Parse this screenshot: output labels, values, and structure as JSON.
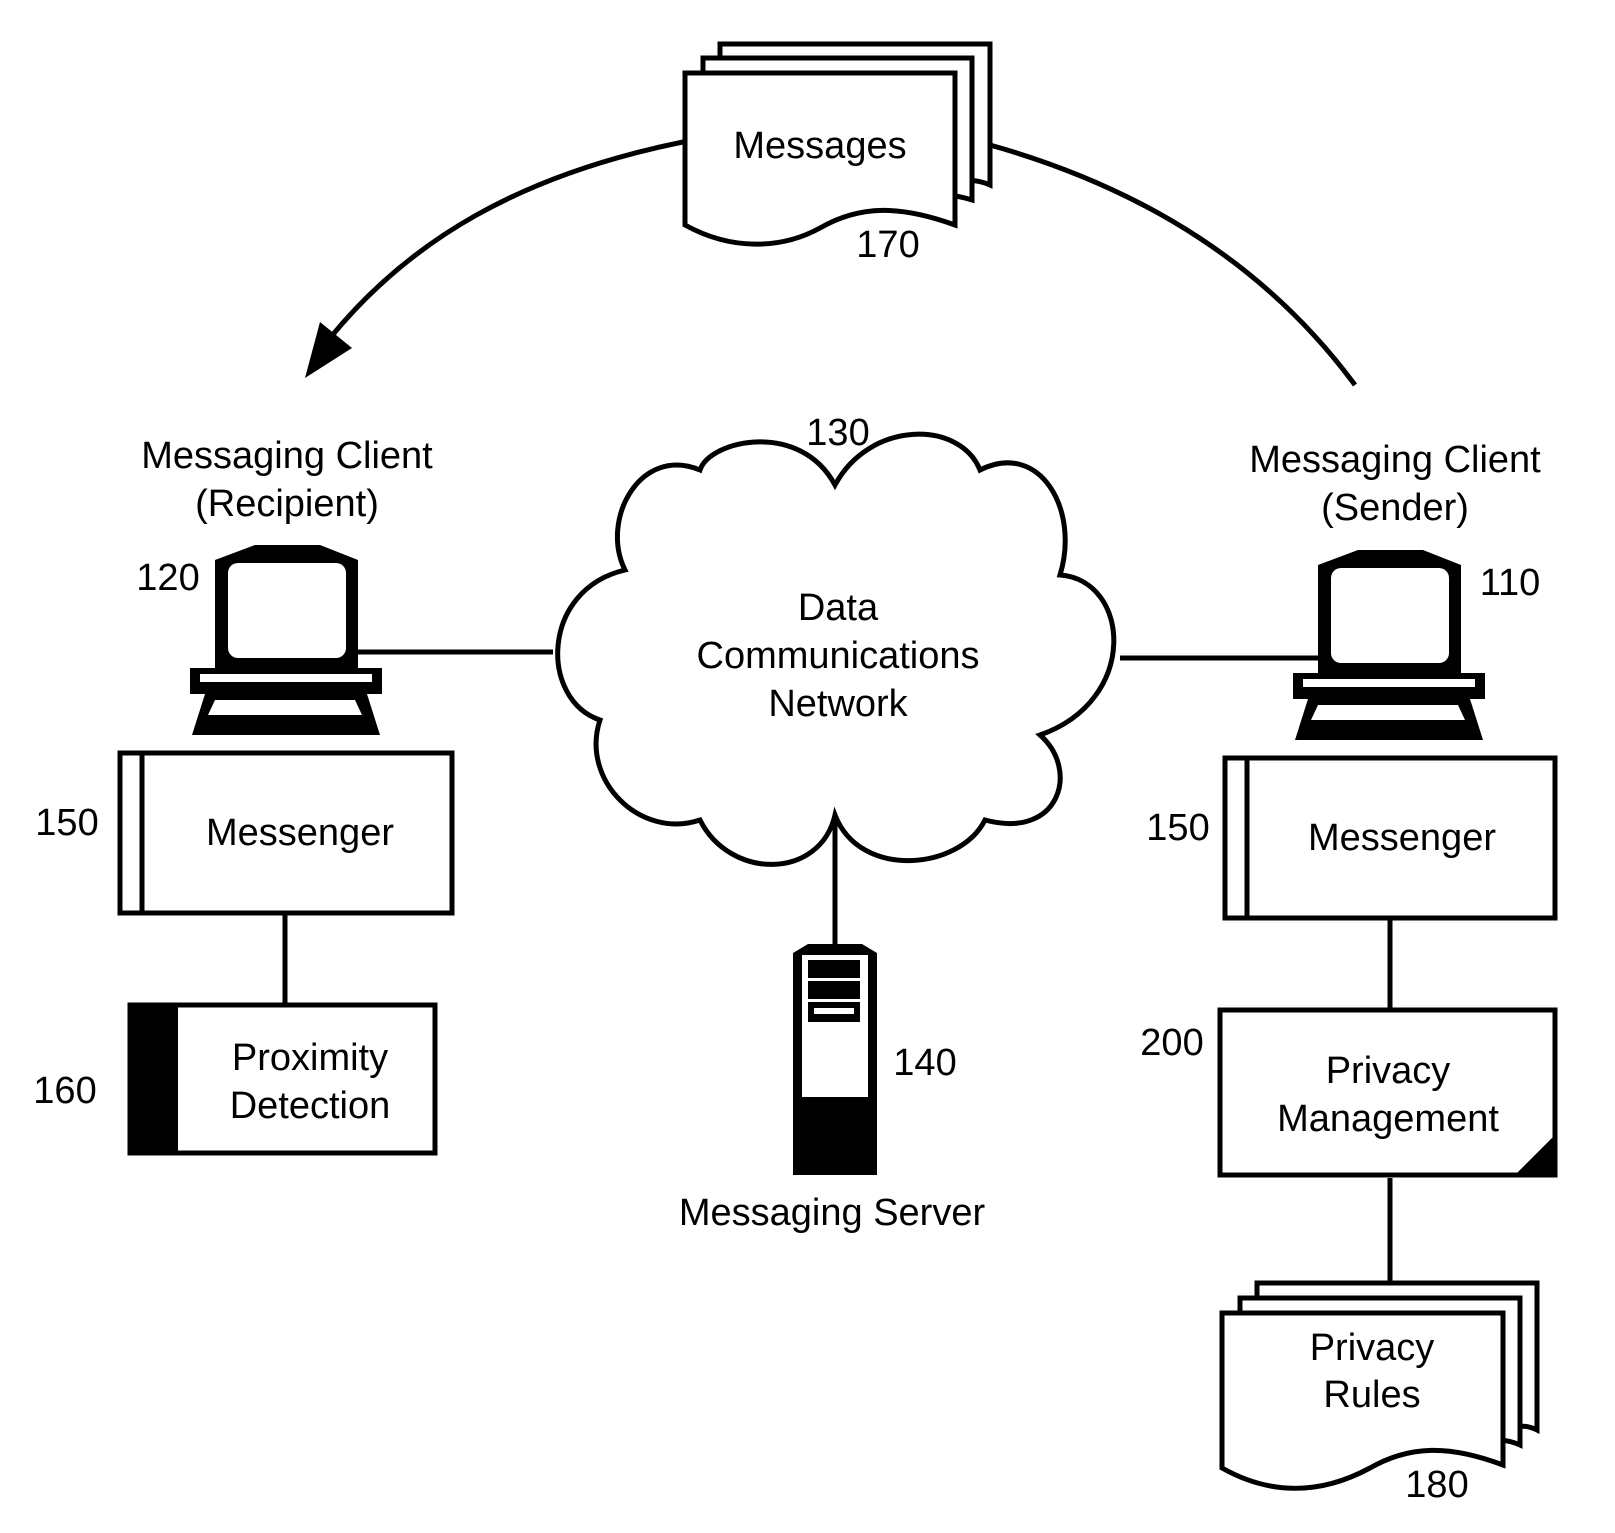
{
  "diagram": {
    "messages": {
      "label": "Messages",
      "ref": "170"
    },
    "network": {
      "line1": "Data",
      "line2": "Communications",
      "line3": "Network",
      "ref": "130"
    },
    "recipient": {
      "title_line1": "Messaging Client",
      "title_line2": "(Recipient)",
      "ref": "120"
    },
    "sender": {
      "title_line1": "Messaging Client",
      "title_line2": "(Sender)",
      "ref": "110"
    },
    "messenger_left": {
      "label": "Messenger",
      "ref": "150"
    },
    "messenger_right": {
      "label": "Messenger",
      "ref": "150"
    },
    "proximity": {
      "line1": "Proximity",
      "line2": "Detection",
      "ref": "160"
    },
    "server": {
      "label": "Messaging Server",
      "ref": "140"
    },
    "privacy_mgmt": {
      "line1": "Privacy",
      "line2": "Management",
      "ref": "200"
    },
    "privacy_rules": {
      "line1": "Privacy",
      "line2": "Rules",
      "ref": "180"
    }
  }
}
